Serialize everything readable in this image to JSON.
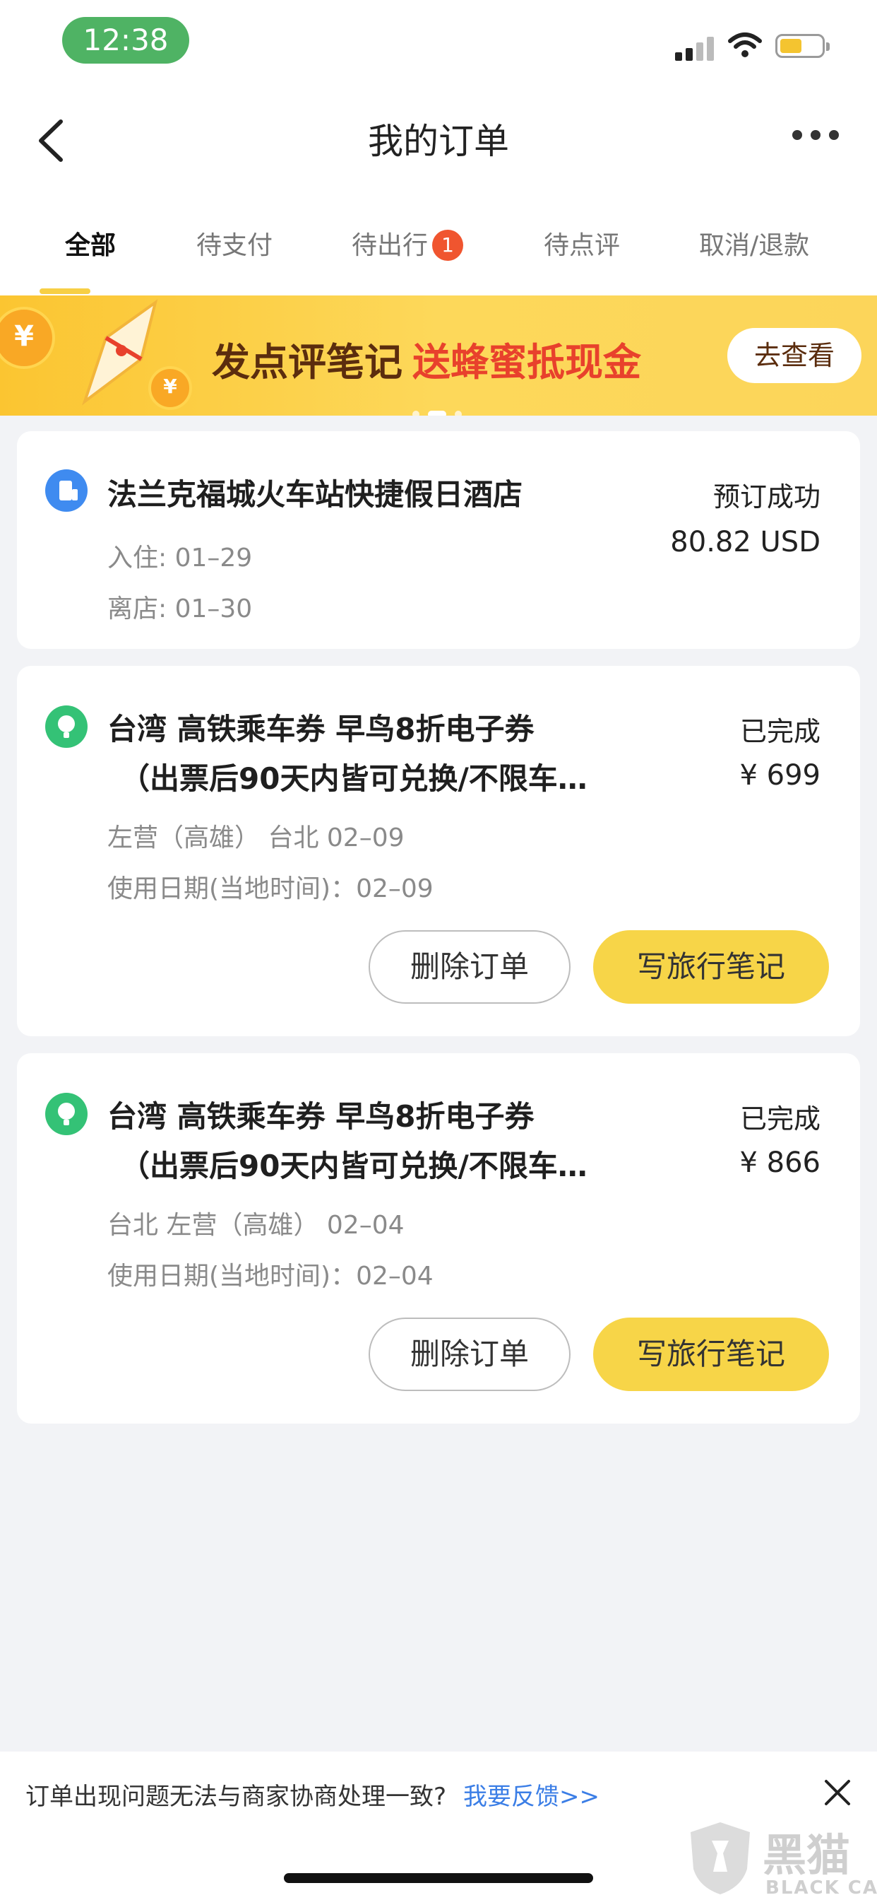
{
  "status_bar": {
    "time": "12:38"
  },
  "nav": {
    "title": "我的订单"
  },
  "tabs": [
    {
      "label": "全部",
      "active": true
    },
    {
      "label": "待支付"
    },
    {
      "label": "待出行",
      "badge": "1"
    },
    {
      "label": "待点评"
    },
    {
      "label": "取消/退款"
    }
  ],
  "banner": {
    "text_main": "发点评笔记",
    "text_highlight": "送蜂蜜抵现金",
    "button": "去查看",
    "coin_symbol": "¥"
  },
  "orders": [
    {
      "category_icon": "hotel-icon",
      "name": "法兰克福城火车站快捷假日酒店",
      "status": "预订成功",
      "price": "80.82 USD",
      "meta": [
        "入住: 01–29",
        "离店: 01–30"
      ]
    },
    {
      "category_icon": "ticket-icon",
      "name_line1": "台湾 高铁乘车券 早鸟8折电子券",
      "name_line2": "（出票后90天内皆可兑换/不限车…",
      "status": "已完成",
      "price": "¥ 699",
      "meta": [
        "左营（高雄） 台北 02–09",
        "使用日期(当地时间)：02–09"
      ],
      "buttons": {
        "delete": "删除订单",
        "note": "写旅行笔记"
      }
    },
    {
      "category_icon": "ticket-icon",
      "name_line1": "台湾 高铁乘车券 早鸟8折电子券",
      "name_line2": "（出票后90天内皆可兑换/不限车…",
      "status": "已完成",
      "price": "¥ 866",
      "meta": [
        "台北 左营（高雄） 02–04",
        "使用日期(当地时间)：02–04"
      ],
      "buttons": {
        "delete": "删除订单",
        "note": "写旅行笔记"
      }
    }
  ],
  "feedback": {
    "question": "订单出现问题无法与商家协商处理一致?",
    "link": "我要反馈>>"
  },
  "watermark": {
    "text": "黑猫",
    "sub": "BLACK CAT"
  },
  "colors": {
    "accent_yellow": "#f7d548",
    "badge_red": "#f0552f",
    "link_blue": "#3b7ee6",
    "hotel_blue": "#3f8bf0",
    "ticket_green": "#34c276",
    "time_pill": "#4fb364"
  }
}
